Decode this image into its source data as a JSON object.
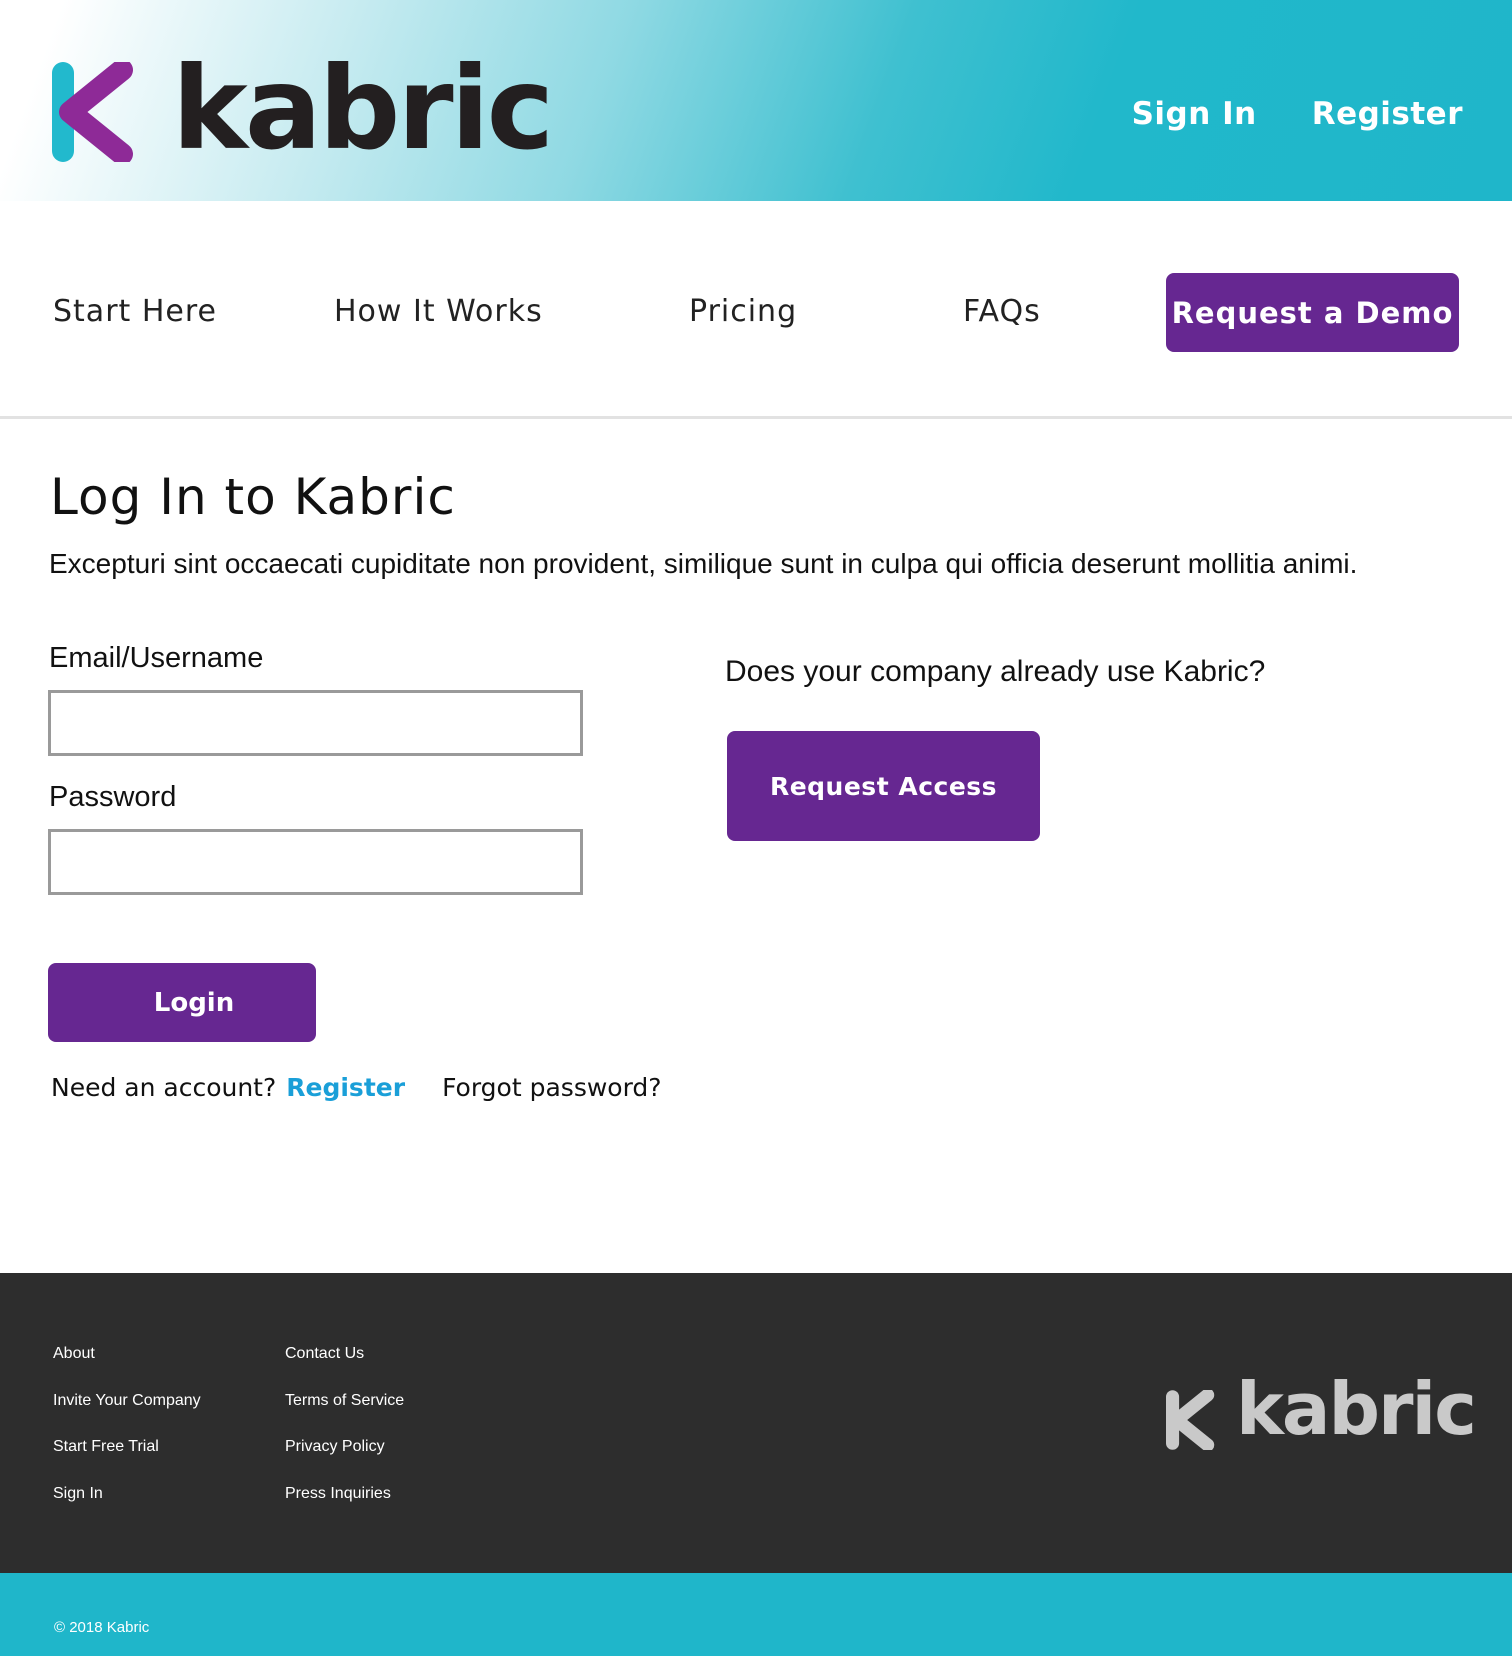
{
  "header": {
    "logo_text": "kabric",
    "sign_in": "Sign In",
    "register": "Register"
  },
  "nav": {
    "items": [
      "Start Here",
      "How It Works",
      "Pricing",
      "FAQs"
    ],
    "demo_button": "Request a Demo"
  },
  "main": {
    "title": "Log In to Kabric",
    "intro": "Excepturi sint occaecati cupiditate non provident, similique sunt in culpa qui officia deserunt mollitia animi.",
    "email_label": "Email/Username",
    "email_value": "",
    "password_label": "Password",
    "password_value": "",
    "login_button": "Login",
    "need_account": "Need an account?",
    "register_link": "Register",
    "forgot_password": "Forgot password?",
    "company_question": "Does your company already use Kabric?",
    "request_access_button": "Request Access"
  },
  "footer": {
    "col1": [
      "About",
      "Invite Your Company",
      "Start Free Trial",
      "Sign In"
    ],
    "col2": [
      "Contact Us",
      "Terms of Service",
      "Privacy Policy",
      "Press Inquiries"
    ],
    "logo_text": "kabric",
    "copyright": "© 2018 Kabric"
  },
  "colors": {
    "brand_teal": "#1fb6ca",
    "brand_purple": "#662791",
    "logo_magenta": "#8e2a97",
    "link_blue": "#1a9fd8",
    "footer_bg": "#2d2d2d"
  },
  "icons": {
    "header_logo": "kabric-k-logo-icon",
    "footer_logo": "kabric-k-logo-icon"
  }
}
